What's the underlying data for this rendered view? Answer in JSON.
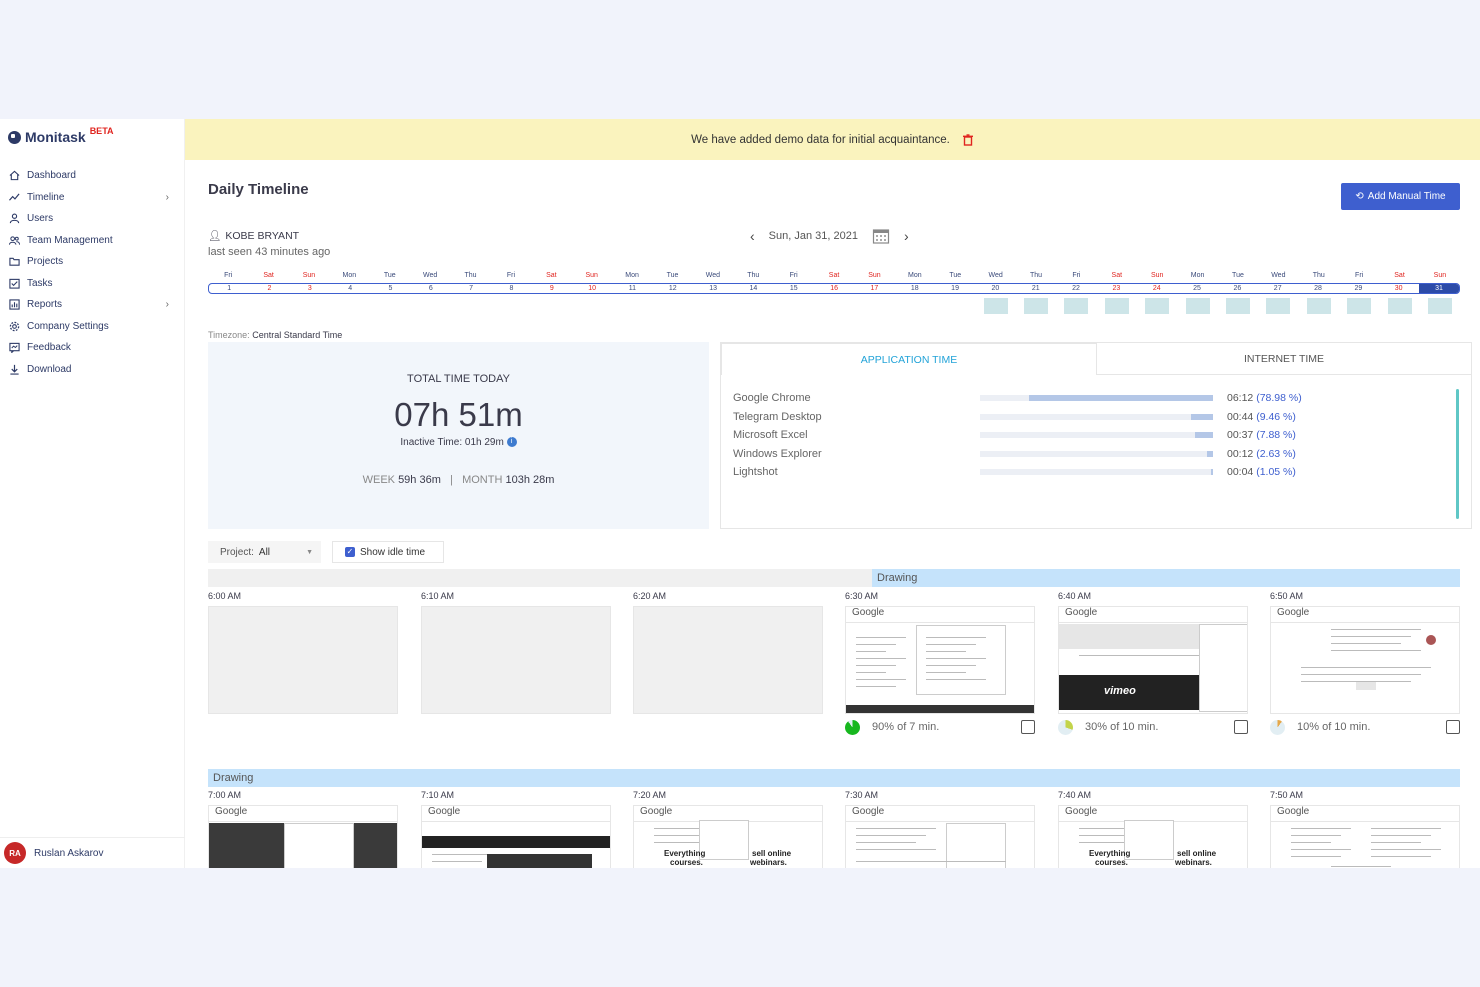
{
  "brand": {
    "name": "Monitask",
    "badge": "BETA"
  },
  "nav": [
    {
      "label": "Dashboard",
      "icon": "home-icon"
    },
    {
      "label": "Timeline",
      "icon": "trend-icon",
      "chevron": true
    },
    {
      "label": "Users",
      "icon": "user-icon"
    },
    {
      "label": "Team Management",
      "icon": "team-icon"
    },
    {
      "label": "Projects",
      "icon": "folder-icon"
    },
    {
      "label": "Tasks",
      "icon": "tasks-icon"
    },
    {
      "label": "Reports",
      "icon": "reports-icon",
      "chevron": true
    },
    {
      "label": "Company Settings",
      "icon": "gear-icon"
    },
    {
      "label": "Feedback",
      "icon": "feedback-icon"
    },
    {
      "label": "Download",
      "icon": "download-icon"
    }
  ],
  "current_user": {
    "initials": "RA",
    "name": "Ruslan Askarov"
  },
  "banner": {
    "text": "We have added demo data for initial acquaintance."
  },
  "page_title": "Daily Timeline",
  "add_button": "Add Manual Time",
  "employee": {
    "name": "KOBE BRYANT",
    "last_seen": "last seen 43 minutes ago"
  },
  "date": "Sun, Jan 31, 2021",
  "calendar": {
    "days": [
      "Fri",
      "Sat",
      "Sun",
      "Mon",
      "Tue",
      "Wed",
      "Thu",
      "Fri",
      "Sat",
      "Sun",
      "Mon",
      "Tue",
      "Wed",
      "Thu",
      "Fri",
      "Sat",
      "Sun",
      "Mon",
      "Tue",
      "Wed",
      "Thu",
      "Fri",
      "Sat",
      "Sun",
      "Mon",
      "Tue",
      "Wed",
      "Thu",
      "Fri",
      "Sat",
      "Sun"
    ],
    "dates": [
      "1",
      "2",
      "3",
      "4",
      "5",
      "6",
      "7",
      "8",
      "9",
      "10",
      "11",
      "12",
      "13",
      "14",
      "15",
      "16",
      "17",
      "18",
      "19",
      "20",
      "21",
      "22",
      "23",
      "24",
      "25",
      "26",
      "27",
      "28",
      "29",
      "30",
      "31"
    ],
    "selected": "31",
    "active_dates": [
      "20",
      "21",
      "22",
      "23",
      "24",
      "25",
      "26",
      "27",
      "28",
      "29",
      "30",
      "31"
    ]
  },
  "timezone": {
    "label": "Timezone:",
    "value": "Central Standard Time"
  },
  "totals": {
    "label": "TOTAL TIME TODAY",
    "value": "07h 51m",
    "inactive_label": "Inactive Time:",
    "inactive_value": "01h 29m",
    "week_label": "WEEK",
    "week_value": "59h 36m",
    "separator": "|",
    "month_label": "MONTH",
    "month_value": "103h 28m"
  },
  "tabs": [
    "APPLICATION TIME",
    "INTERNET TIME"
  ],
  "applications": [
    {
      "name": "Google Chrome",
      "time": "06:12",
      "pct": "(78.98 %)",
      "share": 0.7898
    },
    {
      "name": "Telegram Desktop",
      "time": "00:44",
      "pct": "(9.46 %)",
      "share": 0.0946
    },
    {
      "name": "Microsoft Excel",
      "time": "00:37",
      "pct": "(7.88 %)",
      "share": 0.0788
    },
    {
      "name": "Windows Explorer",
      "time": "00:12",
      "pct": "(2.63 %)",
      "share": 0.0263
    },
    {
      "name": "Lightshot",
      "time": "00:04",
      "pct": "(1.05 %)",
      "share": 0.0105
    }
  ],
  "filter": {
    "label": "Project:",
    "value": "All"
  },
  "idle_toggle": {
    "label": "Show idle time",
    "checked": true
  },
  "bands": {
    "row1": "Drawing",
    "row2": "Drawing"
  },
  "row1": [
    {
      "time": "6:00 AM",
      "has_shot": false
    },
    {
      "time": "6:10 AM",
      "has_shot": false
    },
    {
      "time": "6:20 AM",
      "has_shot": false
    },
    {
      "time": "6:30 AM",
      "has_shot": true,
      "activity": "90% of 7 min.",
      "level": 0.9,
      "color": "#17b71f"
    },
    {
      "time": "6:40 AM",
      "has_shot": true,
      "activity": "30% of 10 min.",
      "level": 0.3,
      "color": "#c3d44b"
    },
    {
      "time": "6:50 AM",
      "has_shot": true,
      "activity": "10% of 10 min.",
      "level": 0.1,
      "color": "#e5a84a"
    }
  ],
  "row2": [
    {
      "time": "7:00 AM"
    },
    {
      "time": "7:10 AM"
    },
    {
      "time": "7:20 AM"
    },
    {
      "time": "7:30 AM"
    },
    {
      "time": "7:40 AM"
    },
    {
      "time": "7:50 AM"
    }
  ],
  "screenshot_text": {
    "google": "Google",
    "vimeo": "vimeo",
    "everything": "Everything",
    "courses": "courses.",
    "online": "sell online",
    "webinars": "webinars."
  }
}
